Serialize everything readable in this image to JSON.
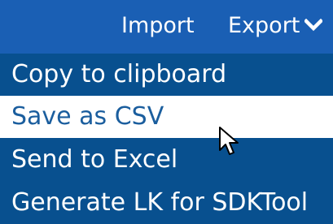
{
  "toolbar": {
    "import_label": "Import",
    "export_label": "Export",
    "export_icon": "chevron-down-icon",
    "background": "#1a5fb4"
  },
  "menu": {
    "items": [
      {
        "label": "Copy to clipboard",
        "state": "normal"
      },
      {
        "label": "Save as CSV",
        "state": "hovered"
      },
      {
        "label": "Send to Excel",
        "state": "normal"
      },
      {
        "label": "Generate LK for SDKTool",
        "state": "normal"
      }
    ],
    "item_background": "#08508f",
    "hover_background": "#ffffff",
    "hover_text_color": "#1b5e9e"
  },
  "cursor_icon": "mouse-pointer-icon"
}
